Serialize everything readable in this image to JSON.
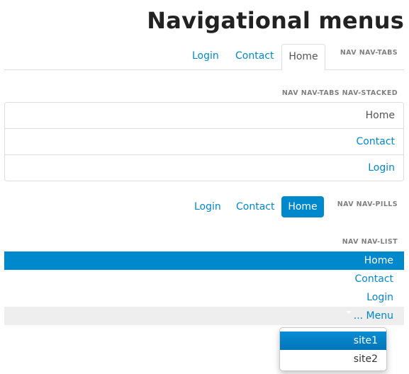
{
  "page_title": "Navigational menus",
  "colors": {
    "accent": "#0088cc",
    "border": "#dddddd",
    "label_gray": "#808080",
    "menu_bg": "#eeeeee"
  },
  "nav_tabs": {
    "label": "NAV NAV-TABS",
    "items": [
      "Login",
      "Contact",
      "Home"
    ],
    "active": "Home"
  },
  "nav_tabs_stacked": {
    "label": "NAV NAV-TABS NAV-STACKED",
    "items": [
      "Home",
      "Contact",
      "Login"
    ],
    "active": "Home"
  },
  "nav_pills": {
    "label": "NAV NAV-PILLS",
    "items": [
      "Login",
      "Contact",
      "Home"
    ],
    "active": "Home"
  },
  "nav_list": {
    "label": "NAV NAV-LIST",
    "items": [
      "Home",
      "Contact",
      "Login"
    ],
    "active": "Home",
    "menu_label": "... Menu",
    "menu_icon": "caret-down-icon"
  },
  "dropdown": {
    "items": [
      "site1",
      "site2"
    ],
    "active": "site1"
  }
}
